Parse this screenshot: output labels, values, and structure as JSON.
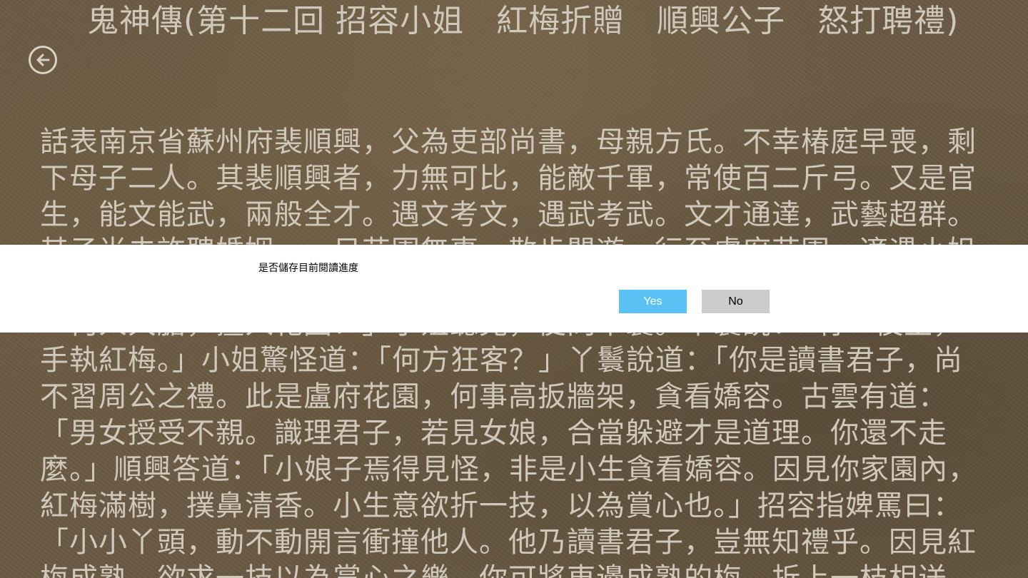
{
  "reader": {
    "back_icon": "arrow-left-circle-icon",
    "chapter_title": "鬼神傳(第十二回 招容小姐　紅梅折贈　順興公子　怒打聘禮)",
    "body_text": "話表南京省蘇州府裴順興，父為吏部尚書，母親方氏。不幸椿庭早喪，剩下母子二人。其裴順興者，力無可比，能敵千軍，常使百二斤弓。又是官生，能文能武，兩般全才。遇文考文，遇武考武。文才通達，武藝超群。其子尚未許聘婚姻。一日花園無事，散步閒遊，行至盧府花園。適遇小姐在園中，賞翫梅花。順興跳過牆來，欲採紅梅一枝。丫鬟看見，叫道：「何人大膽，擅入花園？」小姐聽見，便問丫鬟。丫鬟說：「有一後生，手執紅梅。」小姐驚怪道：「何方狂客？」丫鬟說道：「你是讀書君子，尚不習周公之禮。此是盧府花園，何事高扳牆架，貪看嬌容。古雲有道：「男女授受不親。識理君子，若見女娘，合當躲避才是道理。你還不走麼。」順興答道：「小娘子焉得見怪，非是小生貪看嬌容。因見你家園內，紅梅滿樹，撲鼻清香。小生意欲折一技，以為賞心也。」招容指婢罵曰：「小小丫頭，動不動開言衝撞他人。他乃讀書君子，豈無知禮乎。因見紅梅成熟，欲求一技以為賞心之樂。你可將東邊成熟的梅，折上一枝相送，免其留戀於牆外，恐遊人觀之不雅。」侍婢招雲手折紅梅一枝送生。"
  },
  "dialog": {
    "message": "是否儲存目前閱讀進度",
    "yes_label": "Yes",
    "no_label": "No",
    "yes_color": "#5ac2f5",
    "no_color": "#cccccc"
  }
}
